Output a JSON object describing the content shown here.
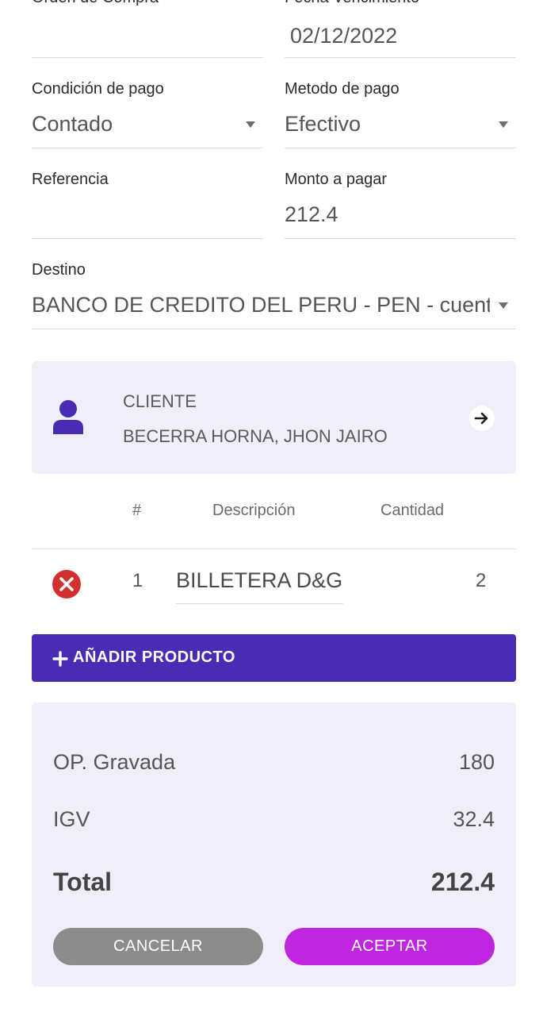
{
  "form": {
    "orden_compra": {
      "label": "Orden de Compra",
      "value": ""
    },
    "fecha_vencimiento": {
      "label": "Fecha Vencimiento",
      "value": "02/12/2022"
    },
    "condicion_pago": {
      "label": "Condición de pago",
      "value": "Contado"
    },
    "metodo_pago": {
      "label": "Metodo de pago",
      "value": "Efectivo"
    },
    "referencia": {
      "label": "Referencia",
      "value": ""
    },
    "monto_pagar": {
      "label": "Monto a pagar",
      "value": "212.4"
    },
    "destino": {
      "label": "Destino",
      "value": "BANCO DE CREDITO DEL PERU - PEN - cuenta"
    }
  },
  "client": {
    "heading": "CLIENTE",
    "name": "BECERRA HORNA, JHON JAIRO",
    "icons": {
      "avatar": "person-icon",
      "go": "arrow-right-icon"
    }
  },
  "products": {
    "headers": [
      "#",
      "Descripción",
      "Cantidad"
    ],
    "rows": [
      {
        "index": "1",
        "description": "BILLETERA D&G",
        "quantity": "2"
      }
    ],
    "add_button": "AÑADIR PRODUCTO"
  },
  "totals": {
    "gravada_label": "OP. Gravada",
    "gravada_value": "180",
    "igv_label": "IGV",
    "igv_value": "32.4",
    "total_label": "Total",
    "total_value": "212.4"
  },
  "actions": {
    "cancel": "CANCELAR",
    "accept": "ACEPTAR"
  },
  "colors": {
    "primary": "#4a2bb3",
    "accept": "#c026e0",
    "cancel": "#8c8c8c",
    "card_bg": "#f0eff9",
    "danger": "#d32f2f"
  }
}
